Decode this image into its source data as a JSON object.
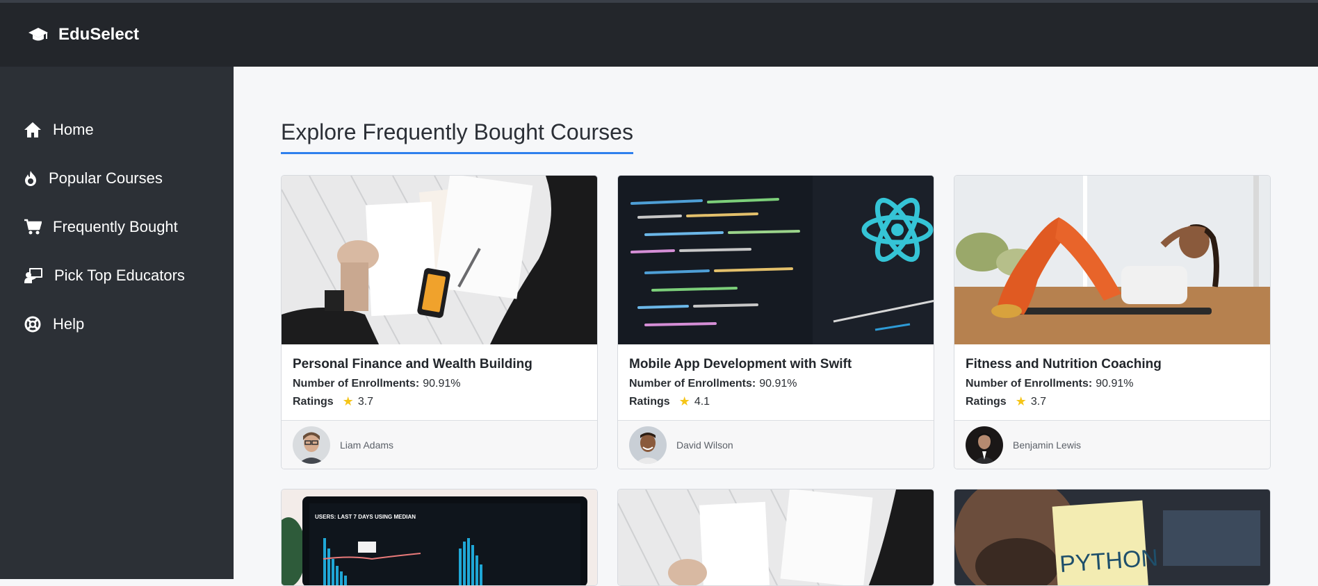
{
  "header": {
    "brand": "EduSelect",
    "logo_icon": "graduation-cap-icon"
  },
  "sidebar": {
    "items": [
      {
        "label": "Home",
        "icon": "home-icon"
      },
      {
        "label": "Popular Courses",
        "icon": "flame-icon"
      },
      {
        "label": "Frequently Bought",
        "icon": "cart-icon"
      },
      {
        "label": "Pick Top Educators",
        "icon": "educator-icon"
      },
      {
        "label": "Help",
        "icon": "lifebuoy-icon"
      }
    ]
  },
  "main": {
    "title": "Explore Frequently Bought Courses",
    "labels": {
      "enrollments": "Number of Enrollments:",
      "ratings": "Ratings"
    },
    "courses": [
      {
        "title": "Personal Finance and Wealth Building",
        "enrollments": "90.91%",
        "rating": "3.7",
        "instructor": "Liam Adams"
      },
      {
        "title": "Mobile App Development with Swift",
        "enrollments": "90.91%",
        "rating": "4.1",
        "instructor": "David Wilson"
      },
      {
        "title": "Fitness and Nutrition Coaching",
        "enrollments": "90.91%",
        "rating": "3.7",
        "instructor": "Benjamin Lewis"
      }
    ],
    "partial_cards": {
      "analytics_header": "USERS: LAST 7 DAYS USING MEDIAN",
      "python_note": "PYTHON"
    }
  },
  "colors": {
    "accent": "#2f80ed",
    "star": "#f5c518",
    "sidebar": "#2c3036",
    "topbar": "#23262b"
  }
}
